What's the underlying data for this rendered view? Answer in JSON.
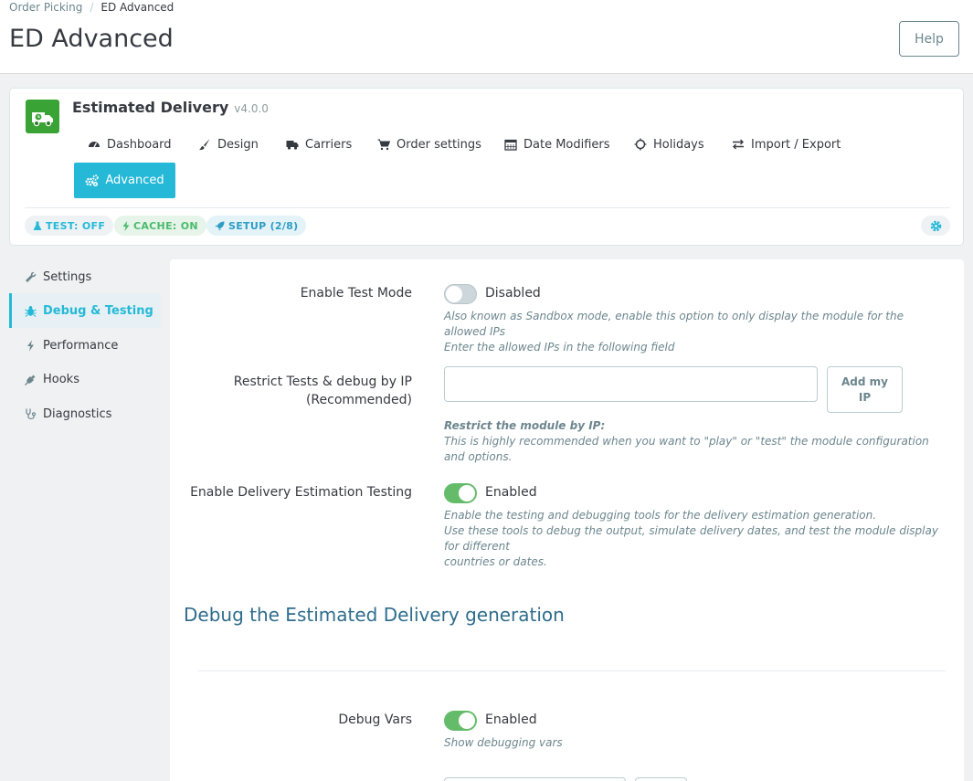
{
  "breadcrumb": {
    "parent": "Order Picking",
    "separator": "/",
    "current": "ED Advanced"
  },
  "page_title": "ED Advanced",
  "help_label": "Help",
  "module": {
    "name": "Estimated Delivery",
    "version": "v4.0.0",
    "nav": [
      "Dashboard",
      "Design",
      "Carriers",
      "Order settings",
      "Date Modifiers",
      "Holidays",
      "Import / Export"
    ],
    "active_nav": "Advanced",
    "badges": {
      "test": "TEST: OFF",
      "cache": "CACHE: ON",
      "setup": "SETUP (2/8)"
    }
  },
  "sidebar": [
    "Settings",
    "Debug & Testing",
    "Performance",
    "Hooks",
    "Diagnostics"
  ],
  "form": {
    "test_mode": {
      "label": "Enable Test Mode",
      "state": "Disabled",
      "help1": "Also known as Sandbox mode, enable this option to only display the module for the allowed IPs",
      "help2": "Enter the allowed IPs in the following field"
    },
    "restrict_ip": {
      "label1": "Restrict Tests & debug by IP",
      "label2": "(Recommended)",
      "value": "",
      "button1": "Add my",
      "button2": "IP",
      "help_bold": "Restrict the module by IP:",
      "help": "This is highly recommended when you want to \"play\" or \"test\" the module configuration and options."
    },
    "estimation_testing": {
      "label": "Enable Delivery Estimation Testing",
      "state": "Enabled",
      "help1": "Enable the testing and debugging tools for the delivery estimation generation.",
      "help2": "Use these tools to debug the output, simulate delivery dates, and test the module display for different",
      "help3": "countries or dates."
    },
    "section_title": "Debug the Estimated Delivery generation",
    "debug_vars": {
      "label": "Debug Vars",
      "state": "Enabled",
      "help": "Show debugging vars"
    }
  },
  "colors": {
    "accent": "#25b9d7",
    "toggle_on": "#64bc6a",
    "section_title": "#2f6d8c"
  }
}
